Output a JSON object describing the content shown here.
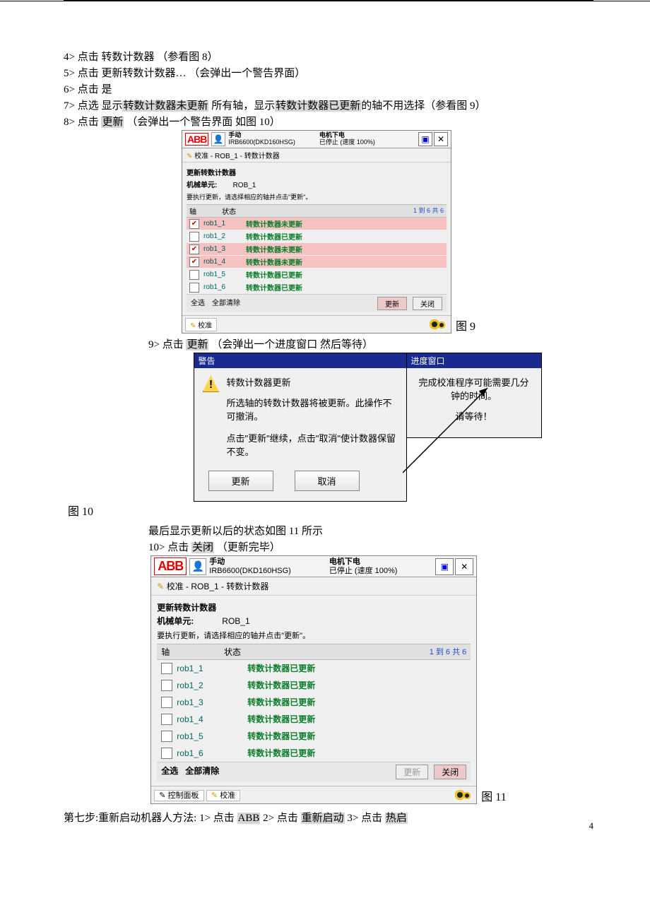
{
  "steps": {
    "s4": "4> 点击 转数计数器        （参看图 8）",
    "s5": "5> 点击 更新转数计数器…      （会弹出一个警告界面）",
    "s6": "6> 点击 是",
    "s7a": "7> 点选 显示",
    "s7b": "转数计数器未更新",
    "s7c": " 所有轴，显示",
    "s7d": "转数计数器已更新",
    "s7e": "的轴不用选择（参看图 9）",
    "s8a": "8> 点击 ",
    "s8b": "更新",
    "s8c": "    （会弹出一个警告界面    如图 10）",
    "s9a": "9> 点击 ",
    "s9b": "更新",
    "s9c": "     （会弹出一个进度窗口    然后等待）",
    "post9": "最后显示更新以后的状态如图 11 所示",
    "s10a": "10> 点击 ",
    "s10b": "关闭",
    "s10c": "     （更新完毕）",
    "s11a": "第七步:重新启动机器人方法:   1> 点击 ",
    "s11b": "ABB",
    "s11c": "    2> 点击 ",
    "s11d": "重新启动",
    "s11e": "   3> 点击 ",
    "s11f": "热启"
  },
  "labels": {
    "fig9": "图  9",
    "fig10": "图  10",
    "fig11": "图  11"
  },
  "abb": {
    "logo": "ABB",
    "mode": "手动",
    "ctrl_s": "IRB6600(DKD160HSG)",
    "ctrl_l": "IRB6600(DKD160HSG)",
    "motor": "电机下电",
    "stopped": "已停止 (速度 100%)",
    "path": "校准 - ROB_1 - 转数计数器",
    "title": "更新转数计数器",
    "mechlbl": "机械单元:",
    "mechval": "ROB_1",
    "instr": "要执行更新，请选择相应的轴并点击\"更新\"。",
    "col_axis": "轴",
    "col_status": "状态",
    "range": "1 到 6 共 6",
    "rows9": [
      {
        "name": "rob1_1",
        "status": "转数计数器未更新",
        "sel": true
      },
      {
        "name": "rob1_2",
        "status": "转数计数器已更新",
        "sel": false
      },
      {
        "name": "rob1_3",
        "status": "转数计数器未更新",
        "sel": true
      },
      {
        "name": "rob1_4",
        "status": "转数计数器未更新",
        "sel": true
      },
      {
        "name": "rob1_5",
        "status": "转数计数器已更新",
        "sel": false
      },
      {
        "name": "rob1_6",
        "status": "转数计数器已更新",
        "sel": false
      }
    ],
    "rows11": [
      {
        "name": "rob1_1",
        "status": "转数计数器已更新"
      },
      {
        "name": "rob1_2",
        "status": "转数计数器已更新"
      },
      {
        "name": "rob1_3",
        "status": "转数计数器已更新"
      },
      {
        "name": "rob1_4",
        "status": "转数计数器已更新"
      },
      {
        "name": "rob1_5",
        "status": "转数计数器已更新"
      },
      {
        "name": "rob1_6",
        "status": "转数计数器已更新"
      }
    ],
    "selall": "全选",
    "clrall": "全部清除",
    "update": "更新",
    "close": "关闭",
    "foot_cal": "校准",
    "foot_panel": "控制面板"
  },
  "dlg": {
    "warn_title": "警告",
    "warn_h": "转数计数器更新",
    "warn_p1": "所选轴的转数计数器将被更新。此操作不可撤消。",
    "warn_p2": "点击\"更新\"继续，点击\"取消\"使计数器保留不变。",
    "btn_update": "更新",
    "btn_cancel": "取消",
    "prog_title": "进度窗口",
    "prog_p1": "完成校准程序可能需要几分钟的时间。",
    "prog_p2": "请等待！"
  },
  "pagenum": "4"
}
